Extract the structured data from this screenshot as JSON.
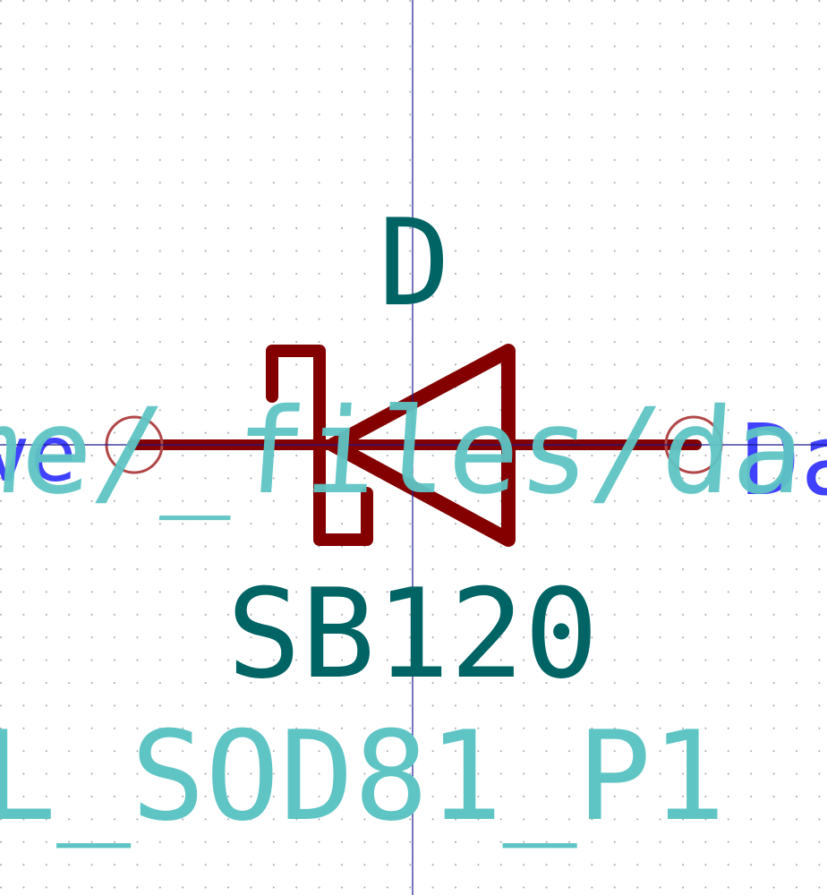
{
  "symbol": {
    "reference": "D",
    "value": "SB120",
    "footprint_fragment": "L_SOD81_P1",
    "path_fragment": "me/_files/da",
    "pin_left_name_fragment": "ve",
    "pin_right_name_fragment": "Da"
  },
  "colors": {
    "background": "#ffffff",
    "grid_dot": "#9aa0a6",
    "crosshair": "#1a1a8c",
    "body": "#840000",
    "reference": "#006464",
    "value": "#006464",
    "fields": "#5fc4c4",
    "pin_name": "#4040ff",
    "pin_marker": "#b04848"
  }
}
